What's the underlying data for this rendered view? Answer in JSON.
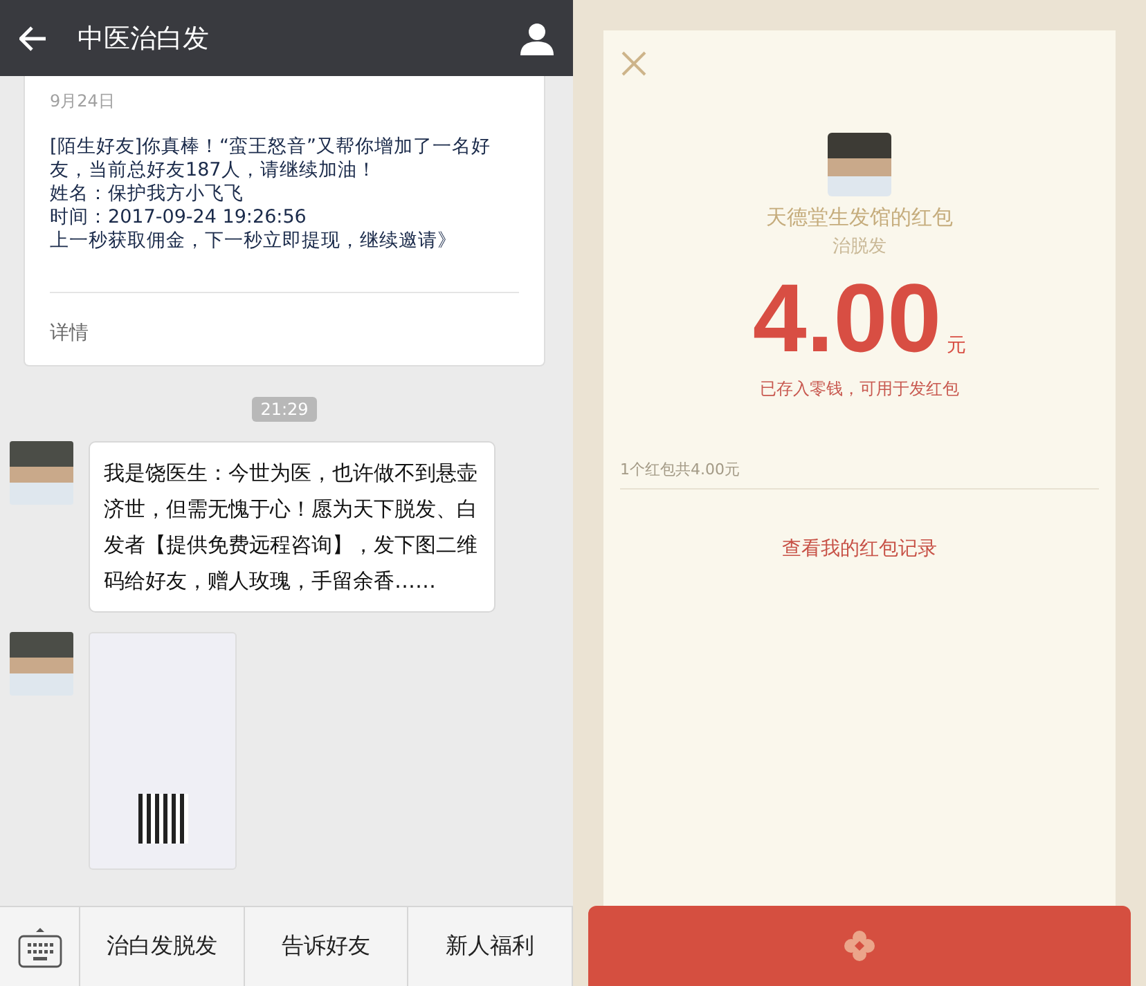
{
  "chat": {
    "title": "中医治白发",
    "notice": {
      "date": "9月24日",
      "lines": [
        "[陌生好友]你真棒！“蛮王怒音”又帮你增加了一名好友，当前总好友187人，请继续加油！",
        "姓名：保护我方小飞飞",
        "时间：2017-09-24 19:26:56",
        "上一秒获取佣金，下一秒立即提现，继续邀请》"
      ],
      "link": "详情"
    },
    "time": "21:29",
    "messages": [
      {
        "kind": "text",
        "text": "我是饶医生：今世为医，也许做不到悬壶济世，但需无愧于心！愿为天下脱发、白发者【提供免费远程咨询】，发下图二维码给好友，赠人玫瑰，手留余香……"
      },
      {
        "kind": "image"
      }
    ],
    "menu": [
      "治白发脱发",
      "告诉好友",
      "新人福利"
    ]
  },
  "red_packet": {
    "sender": "天德堂生发馆的红包",
    "wish": "治脱发",
    "amount": "4.00",
    "unit": "元",
    "note": "已存入零钱，可用于发红包",
    "summary": "1个红包共4.00元",
    "records_link": "查看我的红包记录"
  }
}
